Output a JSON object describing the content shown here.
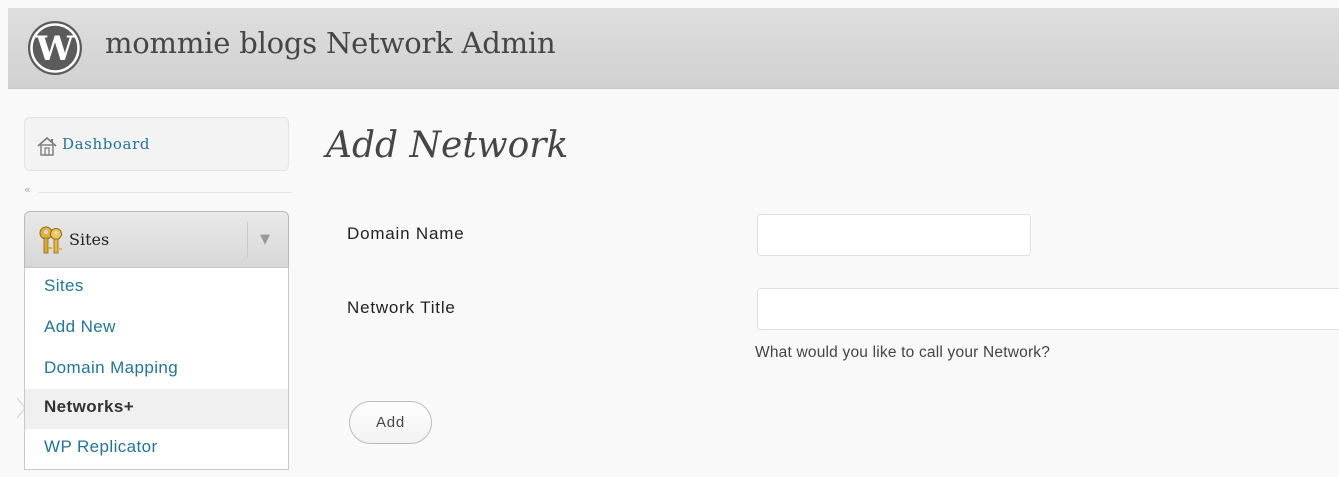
{
  "header": {
    "site_title": "mommie blogs Network Admin",
    "logo_icon": "wordpress-logo-icon"
  },
  "sidebar": {
    "dashboard": {
      "label": "Dashboard",
      "icon": "home-icon"
    },
    "collapse": {
      "glyph": "«",
      "icon": "collapse-icon"
    },
    "sites_menu": {
      "label": "Sites",
      "icon": "keys-icon",
      "toggle_icon": "chevron-down-icon",
      "items": [
        {
          "label": "Sites",
          "current": false
        },
        {
          "label": "Add New",
          "current": false
        },
        {
          "label": "Domain Mapping",
          "current": false
        },
        {
          "label": "Networks+",
          "current": true
        },
        {
          "label": "WP Replicator",
          "current": false
        }
      ]
    }
  },
  "main": {
    "page_title": "Add Network",
    "form": {
      "domain_label": "Domain Name",
      "domain_value": "",
      "title_label": "Network Title",
      "title_value": "",
      "title_description": "What would you like to call your Network?",
      "submit_label": "Add"
    }
  },
  "colors": {
    "link": "#21759b",
    "header_bg": "#d9d9d9",
    "page_bg": "#f9f9f9"
  }
}
